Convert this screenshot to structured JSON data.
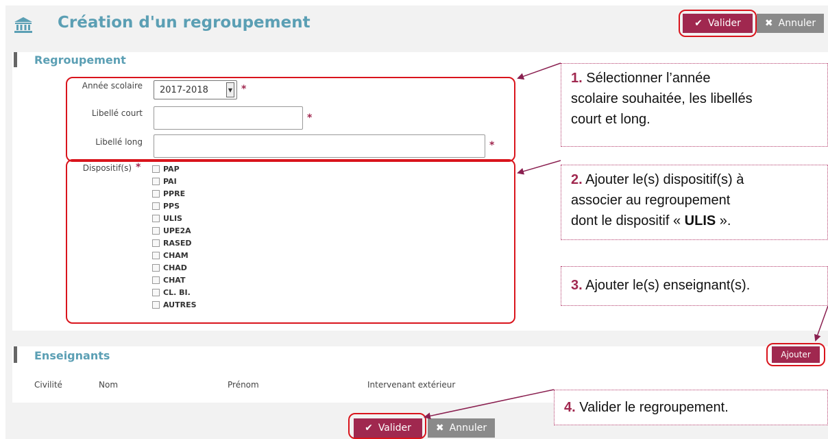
{
  "header": {
    "title": "Création d'un regroupement",
    "validate_label": "Valider",
    "cancel_label": "Annuler"
  },
  "regroupement": {
    "section_title": "Regroupement",
    "annee_label": "Année scolaire",
    "annee_value": "2017-2018",
    "libelle_court_label": "Libellé court",
    "libelle_court_value": "",
    "libelle_long_label": "Libellé long",
    "libelle_long_value": "",
    "dispositifs_label": "Dispositif(s)",
    "required_mark": "*",
    "dispositifs": [
      "PAP",
      "PAI",
      "PPRE",
      "PPS",
      "ULIS",
      "UPE2A",
      "RASED",
      "CHAM",
      "CHAD",
      "CHAT",
      "CL. BI.",
      "AUTRES"
    ]
  },
  "enseignants": {
    "section_title": "Enseignants",
    "add_label": "Ajouter",
    "columns": [
      "Civilité",
      "Nom",
      "Prénom",
      "Intervenant extérieur"
    ]
  },
  "footer": {
    "validate_label": "Valider",
    "cancel_label": "Annuler"
  },
  "callouts": {
    "c1": {
      "num": "1.",
      "text1": "Sélectionner l’année",
      "text2": "scolaire souhaitée, les libellés",
      "text3": "court et long."
    },
    "c2": {
      "num": "2.",
      "text1": "Ajouter le(s) dispositif(s) à",
      "text2": "associer au regroupement",
      "text3_pre": "dont le dispositif « ",
      "text3_bold": "ULIS",
      "text3_post": " »."
    },
    "c3": {
      "num": "3.",
      "text": "Ajouter le(s) enseignant(s)."
    },
    "c4": {
      "num": "4.",
      "text": "Valider le regroupement."
    }
  },
  "colors": {
    "accent": "#a0284f",
    "title_blue": "#5b9fb4",
    "highlight_red": "#d9141c",
    "panel_gray": "#f2f2f2"
  }
}
